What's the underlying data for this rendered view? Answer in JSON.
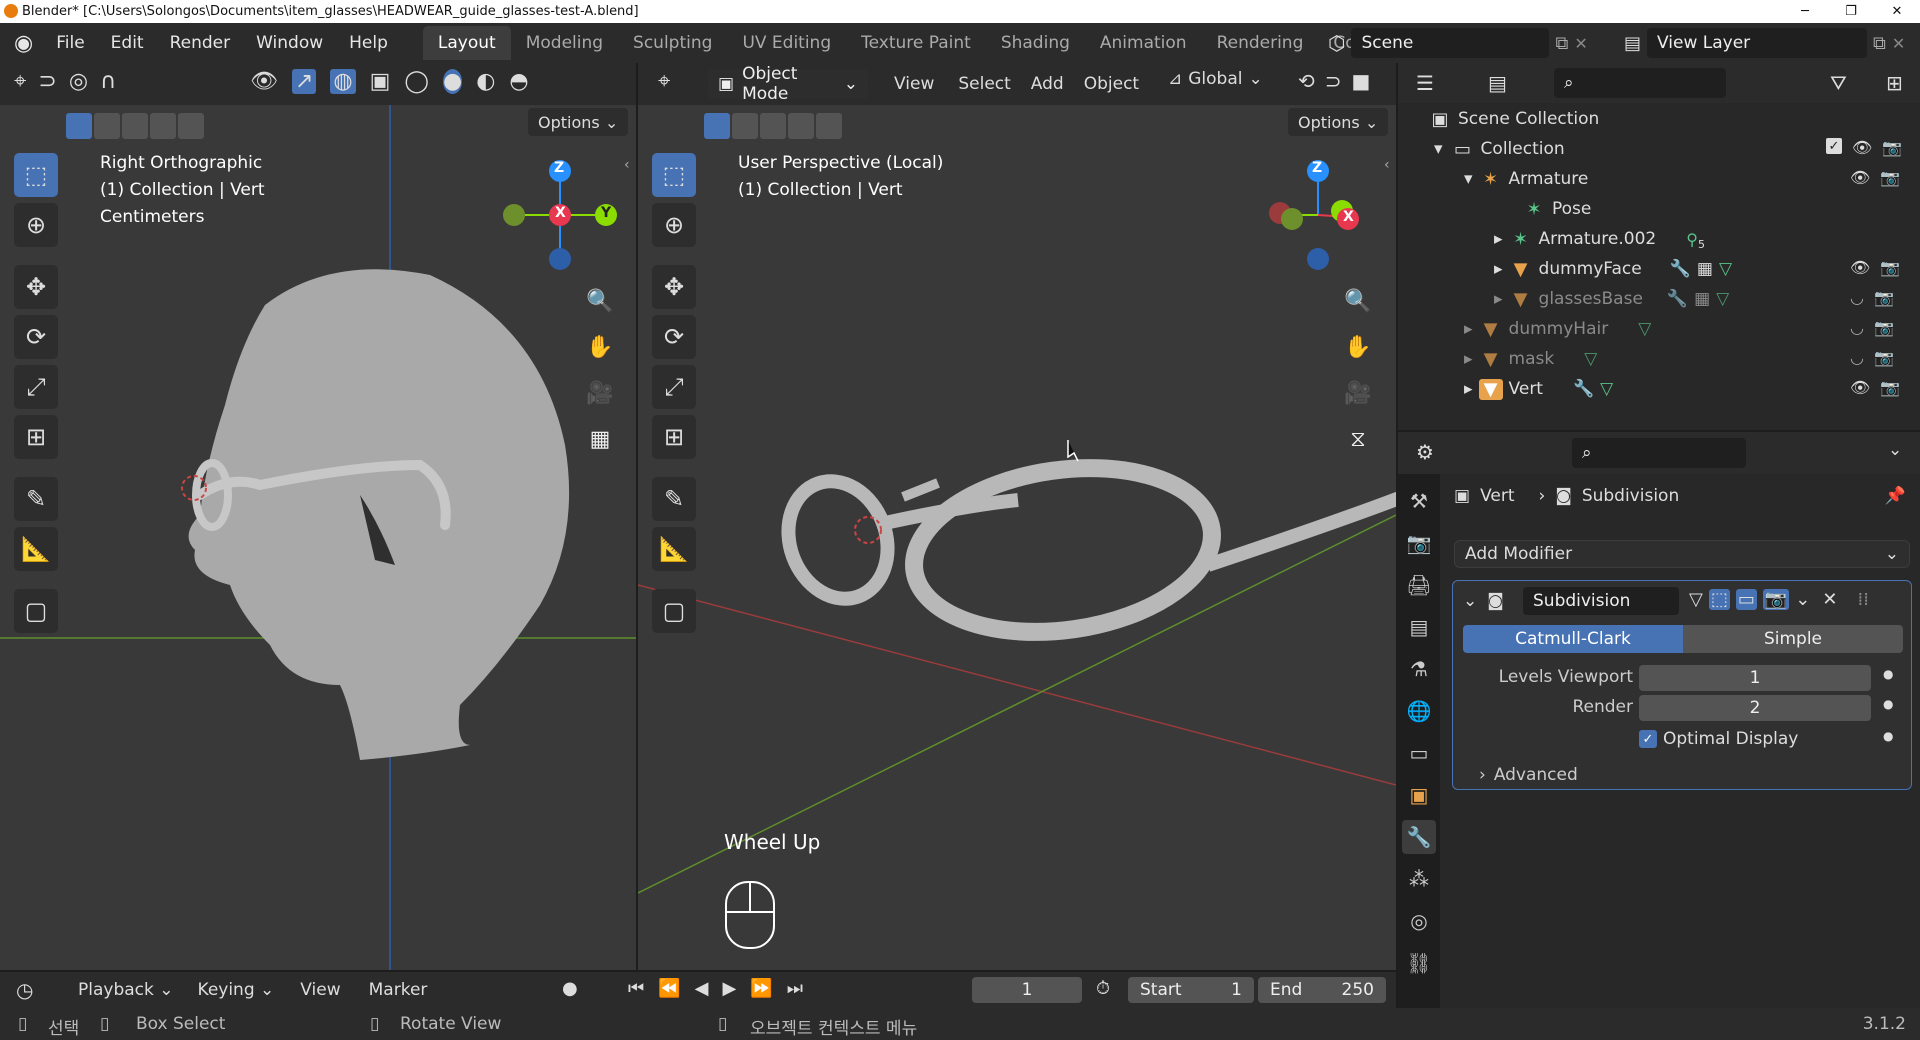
{
  "window": {
    "title": "Blender* [C:\\Users\\Solongos\\Documents\\item_glasses\\HEADWEAR_guide_glasses-test-A.blend]",
    "minimize": "─",
    "maximize": "❐",
    "close": "✕"
  },
  "menus": [
    "File",
    "Edit",
    "Render",
    "Window",
    "Help"
  ],
  "workspaces": [
    "Layout",
    "Modeling",
    "Sculpting",
    "UV Editing",
    "Texture Paint",
    "Shading",
    "Animation",
    "Rendering",
    "Compo"
  ],
  "scene": {
    "name": "Scene",
    "view_layer": "View Layer"
  },
  "left_viewport": {
    "options": "Options",
    "line1": "Right Orthographic",
    "line2": "(1) Collection | Vert",
    "line3": "Centimeters",
    "axes": {
      "z": "Z",
      "y": "Y",
      "x": "X"
    }
  },
  "right_viewport": {
    "mode": "Object Mode",
    "menu": [
      "View",
      "Select",
      "Add",
      "Object"
    ],
    "transform": "Global",
    "options": "Options",
    "line1": "User Perspective (Local)",
    "line2": "(1) Collection | Vert",
    "wheel": "Wheel Up",
    "axes": {
      "z": "Z",
      "x": "X"
    }
  },
  "outliner": {
    "scene_collection": "Scene Collection",
    "items": [
      {
        "label": "Collection"
      },
      {
        "label": "Armature"
      },
      {
        "label": "Pose"
      },
      {
        "label": "Armature.002",
        "badge": "5"
      },
      {
        "label": "dummyFace"
      },
      {
        "label": "glassesBase"
      },
      {
        "label": "dummyHair"
      },
      {
        "label": "mask"
      },
      {
        "label": "Vert"
      }
    ]
  },
  "properties": {
    "breadcrumb_object": "Vert",
    "breadcrumb_modifier": "Subdivision",
    "add_modifier": "Add Modifier",
    "modifier_name": "Subdivision",
    "mode_catmull": "Catmull-Clark",
    "mode_simple": "Simple",
    "levels_viewport_label": "Levels Viewport",
    "levels_viewport_value": "1",
    "render_label": "Render",
    "render_value": "2",
    "optimal_display": "Optimal Display",
    "advanced": "Advanced"
  },
  "timeline": {
    "menu": [
      "Playback",
      "Keying",
      "View",
      "Marker"
    ],
    "current_frame": "1",
    "start_label": "Start",
    "start_value": "1",
    "end_label": "End",
    "end_value": "250"
  },
  "statusbar": {
    "select": "선택",
    "box_select": "Box Select",
    "rotate_view": "Rotate View",
    "context_menu": "오브젝트 컨텍스트 메뉴",
    "version": "3.1.2"
  },
  "colors": {
    "accent": "#4772b3",
    "axis_x": "#e8384f",
    "axis_y": "#8bdc00",
    "axis_z": "#2890ff"
  }
}
